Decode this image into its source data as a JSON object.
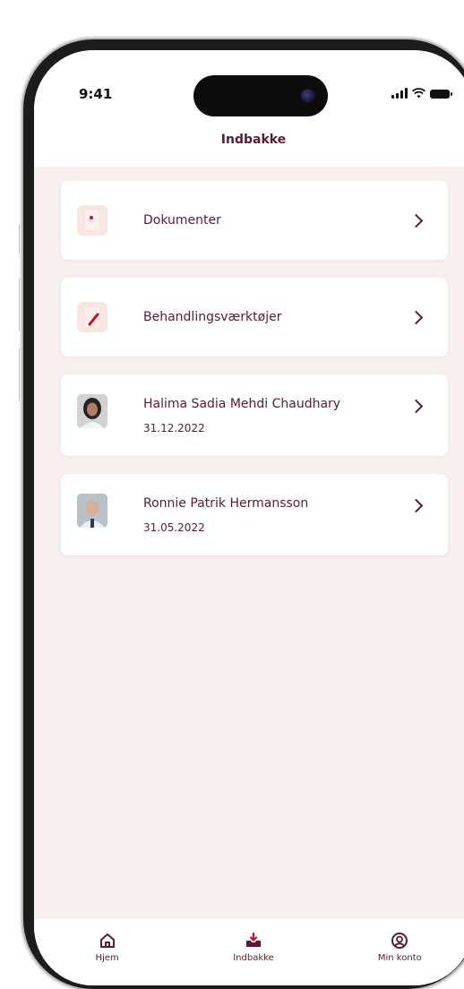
{
  "status_bar": {
    "time": "9:41"
  },
  "header": {
    "title": "Indbakke"
  },
  "items": [
    {
      "label": "Dokumenter",
      "icon": "document-icon"
    },
    {
      "label": "Behandlingsværktøjer",
      "icon": "treatment-tools-icon"
    }
  ],
  "people": [
    {
      "name": "Halima Sadia Mehdi Chaudhary",
      "date": "31.12.2022"
    },
    {
      "name": "Ronnie Patrik Hermansson",
      "date": "31.05.2022"
    }
  ],
  "tabs": [
    {
      "label": "Hjem",
      "icon": "home-icon"
    },
    {
      "label": "Indbakke",
      "icon": "inbox-icon"
    },
    {
      "label": "Min konto",
      "icon": "account-icon"
    }
  ],
  "colors": {
    "accent": "#5a1a33",
    "background": "#f8f0ef",
    "icon_bg": "#f7e6e2",
    "icon_accent": "#c4152a"
  }
}
